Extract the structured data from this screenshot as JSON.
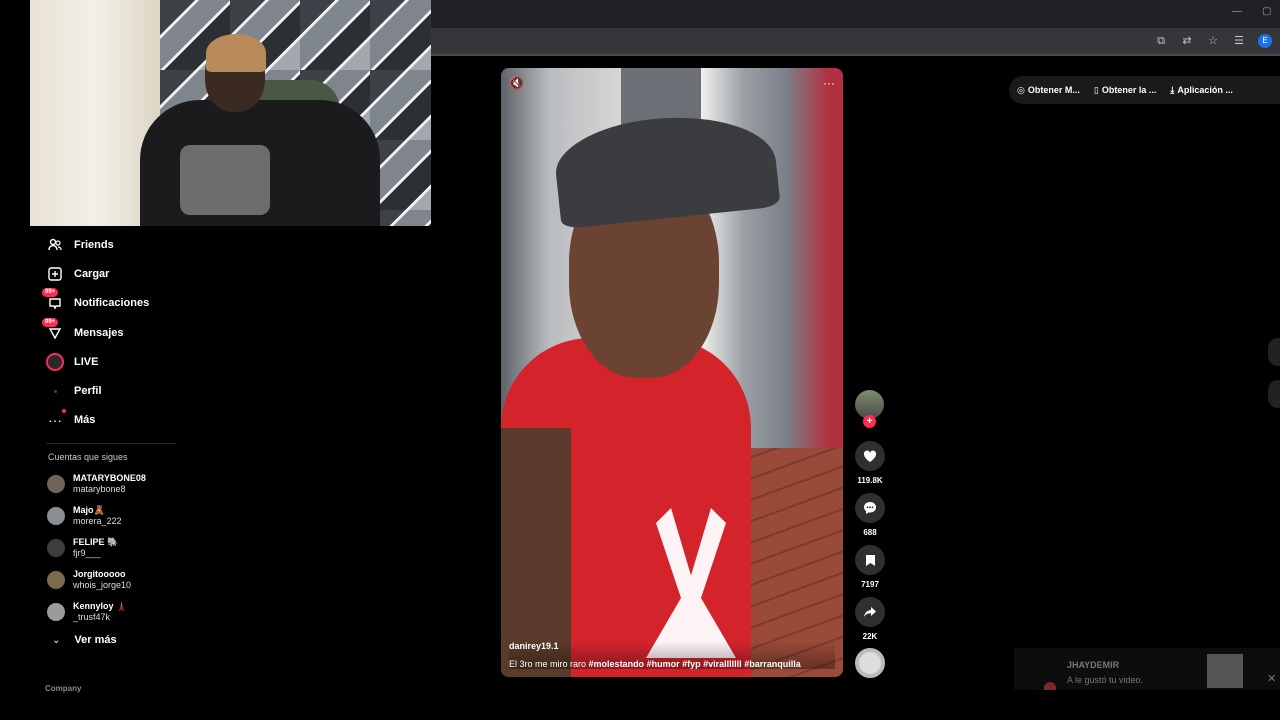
{
  "sidebar": {
    "items": [
      {
        "label": "Friends",
        "icon": "friends-icon"
      },
      {
        "label": "Cargar",
        "icon": "upload-icon"
      },
      {
        "label": "Notificaciones",
        "icon": "inbox-icon",
        "badge": "99+"
      },
      {
        "label": "Mensajes",
        "icon": "messages-icon",
        "badge": "99+"
      },
      {
        "label": "LIVE",
        "icon": "live-icon"
      },
      {
        "label": "Perfil",
        "icon": "profile-icon"
      },
      {
        "label": "Más",
        "icon": "more-icon"
      }
    ],
    "following_title": "Cuentas que sigues",
    "following": [
      {
        "name": "MATARYBONE08",
        "user": "matarybone8"
      },
      {
        "name": "Majo🧸",
        "user": "morera_222"
      },
      {
        "name": "FELIPE 🐘",
        "user": "fjr9___"
      },
      {
        "name": "Jorgitooooo",
        "user": "whois_jorge10"
      },
      {
        "name": "Kennyloy 🗼",
        "user": "_trusf47k"
      }
    ],
    "see_more": "Ver más",
    "company": "Company"
  },
  "video": {
    "author": "danirey19.1",
    "caption": "El 3ro me miro raro",
    "hashtags": [
      "#molestando",
      "#humor",
      "#fyp",
      "#viralllllll",
      "#barranquilla"
    ],
    "more_label": "···"
  },
  "actions": {
    "likes": "119.8K",
    "comments": "688",
    "saves": "7197",
    "shares": "22K"
  },
  "topbar": {
    "buttons": [
      "Obtener M...",
      "Obtener la ...",
      "Aplicación ..."
    ]
  },
  "toast": {
    "name": "JHAYDEMIR",
    "message": "A le gustó tu video."
  },
  "browser": {
    "profile_initial": "E"
  },
  "colors": {
    "accent": "#fe2c55",
    "background": "#000000"
  }
}
